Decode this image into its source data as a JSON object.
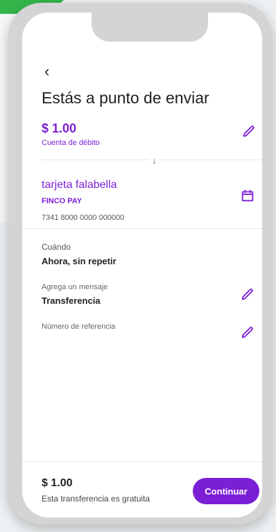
{
  "header": {
    "back_icon": "chevron-left-icon",
    "title": "Estás a punto de enviar"
  },
  "transfer": {
    "amount": "$ 1.00",
    "account_type": "Cuenta de débito"
  },
  "recipient": {
    "name": "tarjeta falabella",
    "bank": "FINCO PAY",
    "account_number": "7341 8000 0000 000000"
  },
  "fields": {
    "when_label": "Cuándo",
    "when_value": "Ahora, sin repetir",
    "message_label": "Agrega un mensaje",
    "message_value": "Transferencia",
    "reference_label": "Número de referencia"
  },
  "footer": {
    "amount": "$ 1.00",
    "note": "Esta transferencia es gratuita",
    "continue_label": "Continuar"
  },
  "colors": {
    "accent": "#7b1fd6",
    "text": "#1f1f1f",
    "bg": "#eef1f3"
  }
}
